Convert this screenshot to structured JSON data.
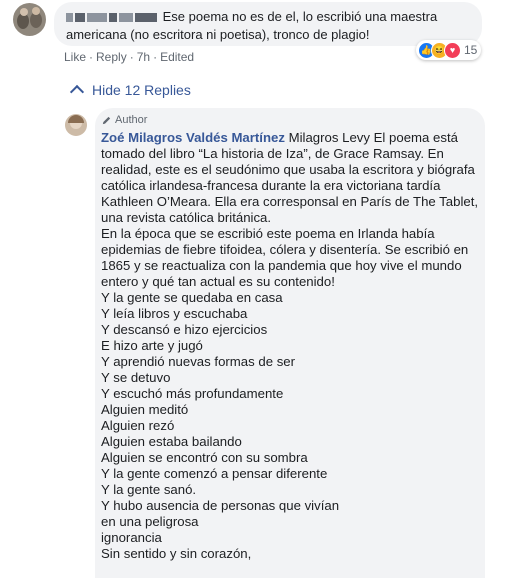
{
  "comment1": {
    "text": "Ese poema no es de el, lo escribió una maestra americana (no escritora ni poetisa), tronco de plagio!",
    "actions": {
      "like": "Like",
      "reply": "Reply",
      "time": "7h",
      "edited": "Edited"
    },
    "reactions": {
      "icons": [
        "like-icon",
        "haha-icon",
        "love-icon"
      ],
      "count": "15"
    }
  },
  "hide_replies": "Hide 12 Replies",
  "reply": {
    "badge": "Author",
    "author": "Zoé Milagros Valdés Martínez",
    "lines": [
      " Milagros Levy El poema está",
      "tomado del libro “La historia de Iza”, de Grace Ramsay. En",
      "realidad, este es el seudónimo que usaba la escritora y biógrafa",
      "católica irlandesa-francesa durante la era victoriana tardía",
      "Kathleen O’Meara. Ella era corresponsal en París de The Tablet,",
      "una revista católica británica.",
      "En la época que se escribió este poema en Irlanda había",
      "epidemias de fiebre tifoidea, cólera y disentería. Se escribió en",
      "1865 y se reactualiza con la pandemia que hoy vive el mundo",
      "entero y qué tan actual es su contenido!",
      "Y la gente se quedaba en casa",
      "Y leía libros y escuchaba",
      "Y descansó e hizo ejercicios",
      "E hizo arte y jugó",
      "Y aprendió nuevas formas de ser",
      "Y se detuvo",
      "Y escuchó más profundamente",
      "Alguien meditó",
      "Alguien rezó",
      "Alguien estaba bailando",
      "Alguien se encontró con su sombra",
      "Y la gente comenzó a pensar diferente",
      "Y la gente sanó.",
      "Y hubo ausencia de personas que vivían",
      "en una peligrosa",
      "ignorancia",
      "Sin sentido y sin corazón,"
    ]
  }
}
